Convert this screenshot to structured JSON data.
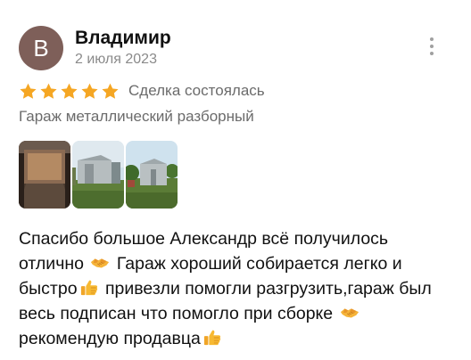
{
  "review": {
    "avatar_letter": "В",
    "author_name": "Владимир",
    "date": "2 июля 2023",
    "rating": 5,
    "rating_max": 5,
    "deal_status": "Сделка состоялась",
    "item_title": "Гараж металлический разборный",
    "photos": [
      {
        "icon": "photo-garage-interior"
      },
      {
        "icon": "photo-garage-exterior"
      },
      {
        "icon": "photo-garage-field"
      }
    ],
    "text": {
      "part1": "Спасибо большое Александр всё получилось отлично",
      "part2": "Гараж хороший собирается легко и быстро",
      "part3": "привезли помогли разгрузить,гараж был весь подписан что помогло при сборке",
      "part4": "рекомендую продавца"
    },
    "emojis": [
      "handshake-icon",
      "thumbs-up-icon"
    ]
  },
  "colors": {
    "star": "#f5a623",
    "avatar_bg": "#7e5f59",
    "muted_text": "#8a8a8a"
  }
}
